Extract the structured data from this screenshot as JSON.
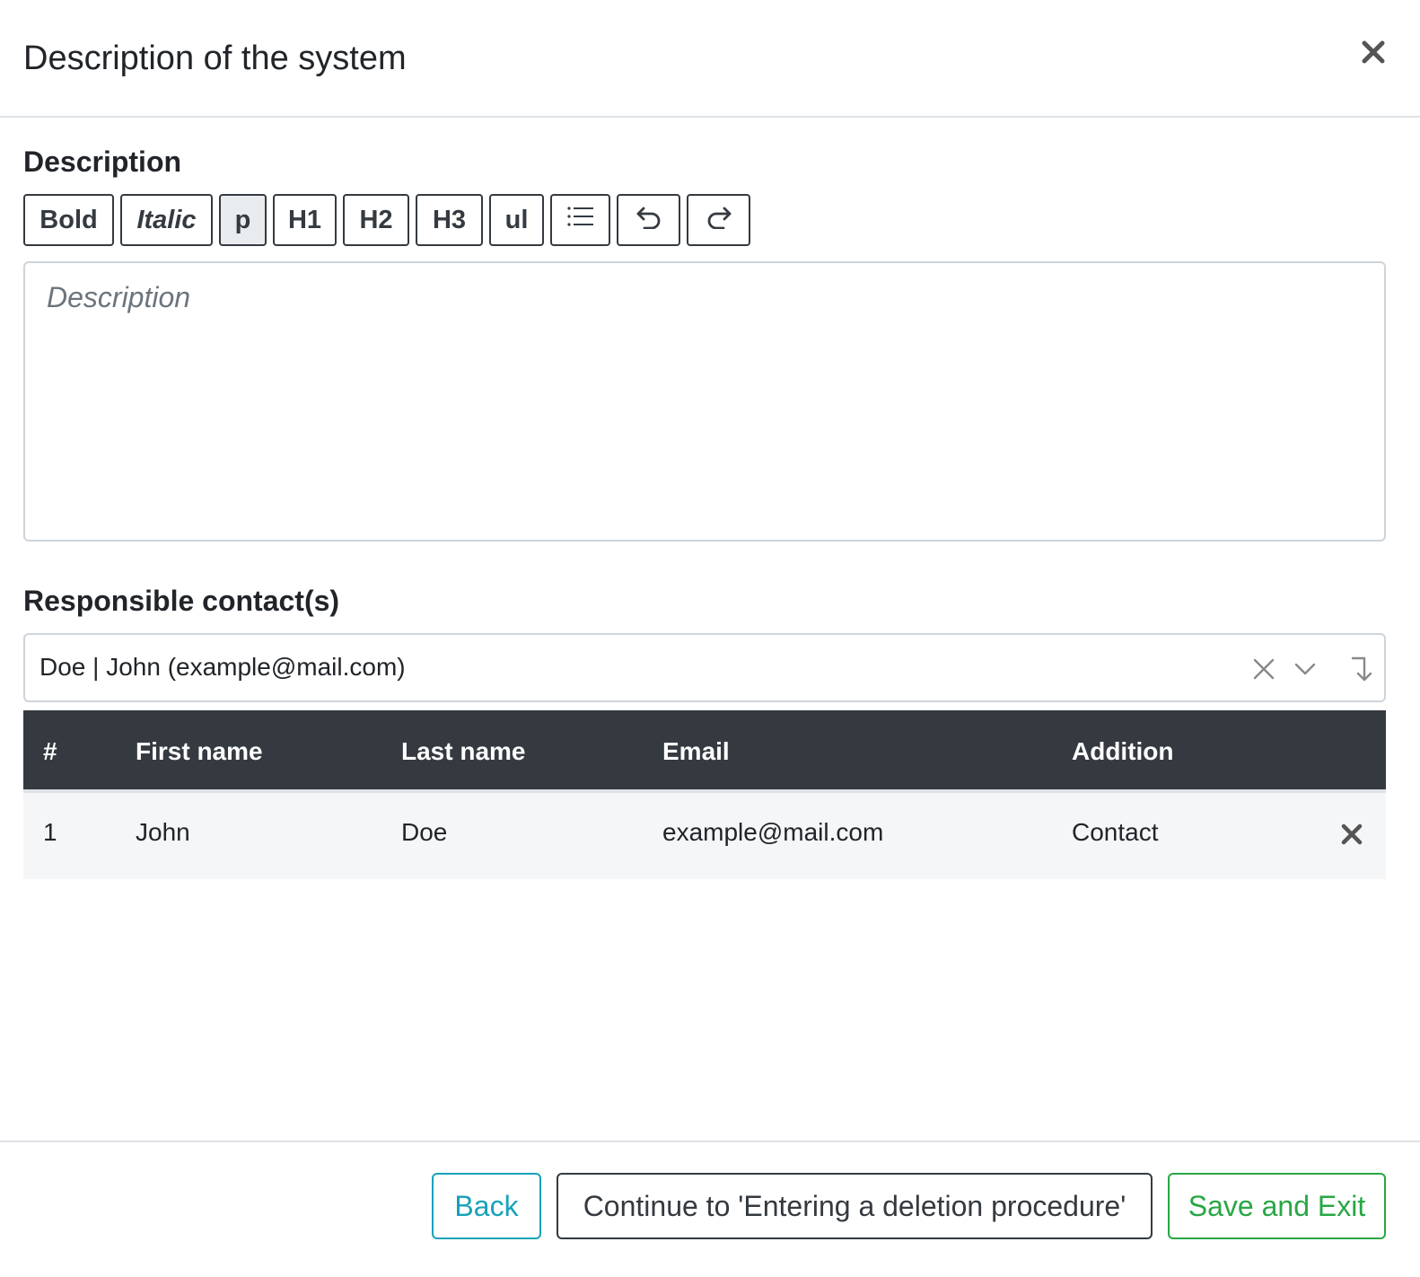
{
  "modal": {
    "title": "Description of the system"
  },
  "description": {
    "label": "Description",
    "placeholder": "Description",
    "toolbar": {
      "bold": "Bold",
      "italic": "Italic",
      "p": "p",
      "h1": "H1",
      "h2": "H2",
      "h3": "H3",
      "ul": "ul",
      "ordered_list_icon": "list-icon",
      "undo_icon": "undo-icon",
      "redo_icon": "redo-icon",
      "active": "p"
    }
  },
  "contacts": {
    "label": "Responsible contact(s)",
    "selected_value": "Doe | John (example@mail.com)",
    "table": {
      "headers": [
        "#",
        "First name",
        "Last name",
        "Email",
        "Addition"
      ],
      "rows": [
        {
          "num": "1",
          "first_name": "John",
          "last_name": "Doe",
          "email": "example@mail.com",
          "addition": "Contact"
        }
      ]
    }
  },
  "footer": {
    "back_label": "Back",
    "continue_label": "Continue to 'Entering a deletion procedure'",
    "save_label": "Save and Exit"
  },
  "colors": {
    "header_bg": "#343a40",
    "back": "#17a2b8",
    "save": "#28a745"
  }
}
